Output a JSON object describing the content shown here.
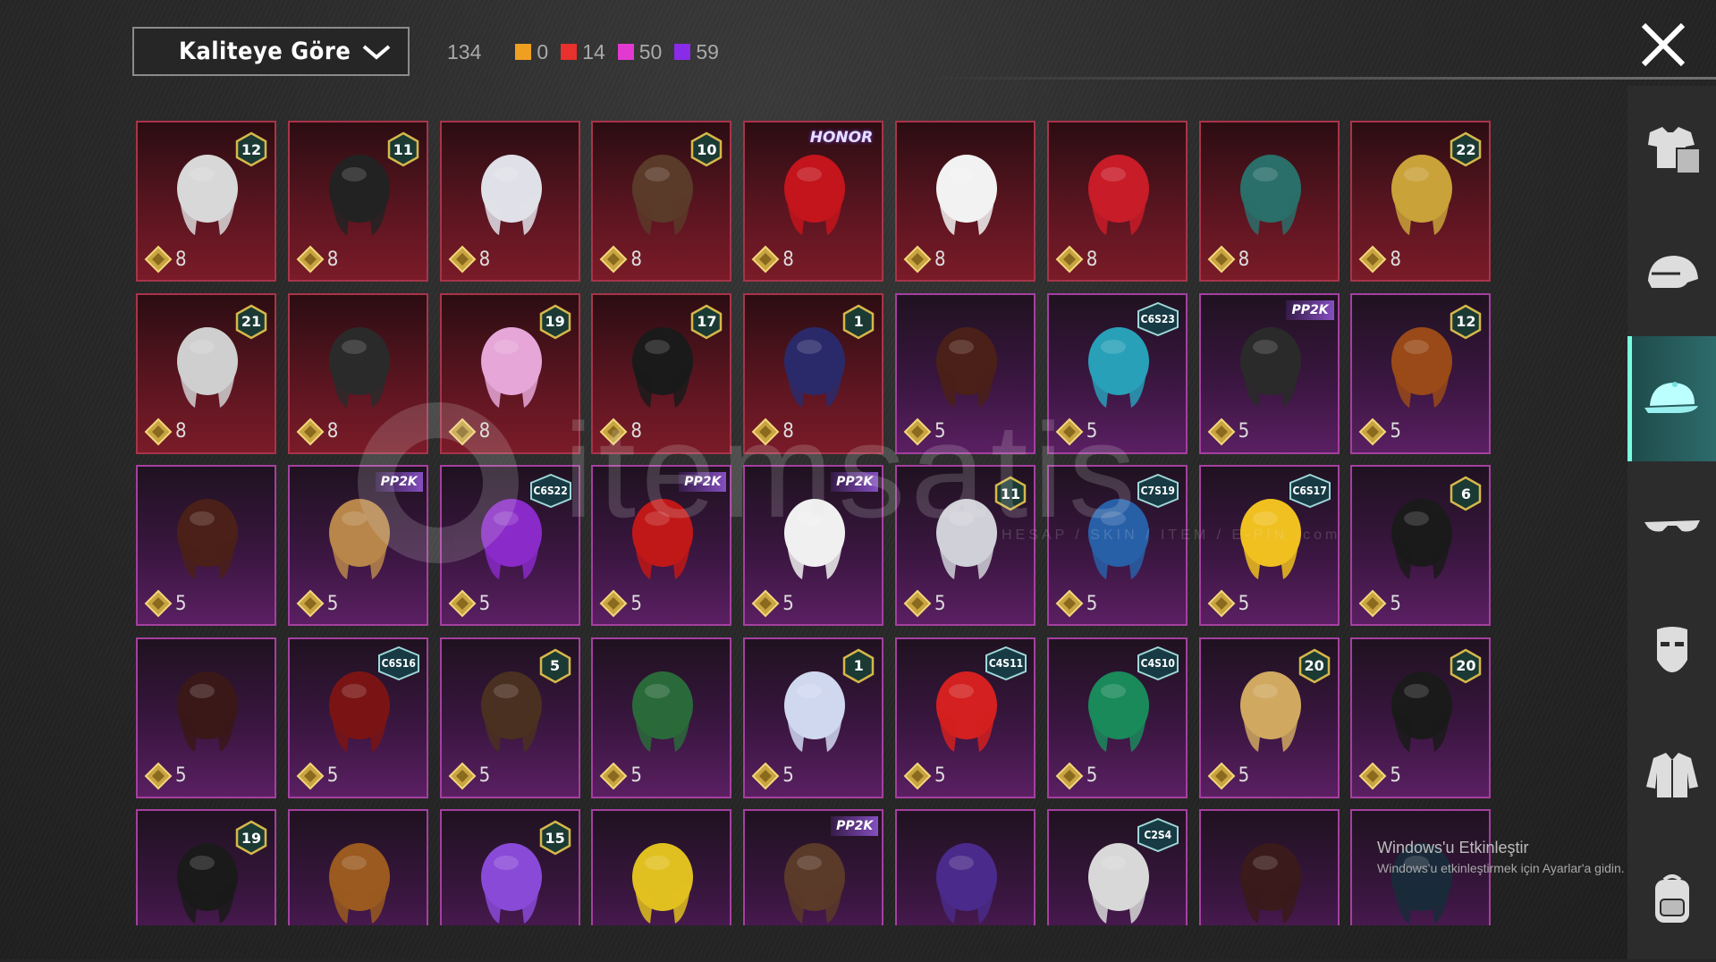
{
  "header": {
    "sort_dropdown": {
      "selected": "Kaliteye Göre"
    },
    "total_count": "134",
    "quality_counts": [
      {
        "color": "#f0a020",
        "count": "0"
      },
      {
        "color": "#e8302c",
        "count": "14"
      },
      {
        "color": "#e23ad0",
        "count": "50"
      },
      {
        "color": "#8a2be8",
        "count": "59"
      }
    ]
  },
  "sidebar": {
    "categories": [
      {
        "name": "outfit",
        "icon": "outfit-icon",
        "active": false
      },
      {
        "name": "helmet",
        "icon": "helmet-icon",
        "active": false
      },
      {
        "name": "hat",
        "icon": "cap-icon",
        "active": true
      },
      {
        "name": "glasses",
        "icon": "glasses-icon",
        "active": false
      },
      {
        "name": "mask",
        "icon": "mask-icon",
        "active": false
      },
      {
        "name": "jacket",
        "icon": "jacket-icon",
        "active": false
      },
      {
        "name": "backpack",
        "icon": "backpack-icon",
        "active": false
      }
    ]
  },
  "items": [
    {
      "rarity": "red",
      "cost": "8",
      "badge": "12",
      "icon": "white-hair-icon"
    },
    {
      "rarity": "red",
      "cost": "8",
      "badge": "11",
      "icon": "black-hair-icon"
    },
    {
      "rarity": "red",
      "cost": "8",
      "icon": "white-long-hair-icon"
    },
    {
      "rarity": "red",
      "cost": "8",
      "badge": "10",
      "icon": "brown-hair-icon"
    },
    {
      "rarity": "red",
      "cost": "8",
      "ribbon": "HONOR",
      "icon": "red-hair-icon"
    },
    {
      "rarity": "red",
      "cost": "8",
      "icon": "cowboy-hat-icon"
    },
    {
      "rarity": "red",
      "cost": "8",
      "icon": "red-helmet-icon"
    },
    {
      "rarity": "red",
      "cost": "8",
      "icon": "teal-helmet-icon"
    },
    {
      "rarity": "red",
      "cost": "8",
      "badge": "22",
      "icon": "gold-helmet-icon"
    },
    {
      "rarity": "red",
      "cost": "8",
      "badge": "21",
      "icon": "oni-mask-icon"
    },
    {
      "rarity": "red",
      "cost": "8",
      "icon": "fox-helmet-icon"
    },
    {
      "rarity": "red",
      "cost": "8",
      "badge": "19",
      "icon": "pink-helmet-icon"
    },
    {
      "rarity": "red",
      "cost": "8",
      "badge": "17",
      "icon": "gold-crown-icon"
    },
    {
      "rarity": "red",
      "cost": "8",
      "badge": "1",
      "icon": "dark-helmet-icon"
    },
    {
      "rarity": "purple",
      "cost": "5",
      "icon": "brown-hair-icon"
    },
    {
      "rarity": "purple",
      "cost": "5",
      "tag": "C6S23",
      "icon": "headphones-icon"
    },
    {
      "rarity": "purple",
      "cost": "5",
      "ribbon": "PP2K",
      "icon": "cap-icon"
    },
    {
      "rarity": "purple",
      "cost": "5",
      "badge": "12",
      "icon": "ponytail-icon"
    },
    {
      "rarity": "purple",
      "cost": "5",
      "icon": "horned-hair-icon"
    },
    {
      "rarity": "purple",
      "cost": "5",
      "ribbon": "PP2K",
      "icon": "alpaca-icon"
    },
    {
      "rarity": "purple",
      "cost": "5",
      "tag": "C6S22",
      "icon": "blue-hair-icon"
    },
    {
      "rarity": "purple",
      "cost": "5",
      "ribbon": "PP2K",
      "icon": "red-hair-icon"
    },
    {
      "rarity": "purple",
      "cost": "5",
      "ribbon": "PP2K",
      "icon": "panda-icon"
    },
    {
      "rarity": "purple",
      "cost": "5",
      "badge": "11",
      "icon": "flower-hair-icon"
    },
    {
      "rarity": "purple",
      "cost": "5",
      "tag": "C7S19",
      "icon": "dreadlocks-icon"
    },
    {
      "rarity": "purple",
      "cost": "5",
      "tag": "C6S17",
      "icon": "visor-icon"
    },
    {
      "rarity": "purple",
      "cost": "5",
      "badge": "6",
      "icon": "knight-helmet-icon"
    },
    {
      "rarity": "purple",
      "cost": "5",
      "icon": "bun-hair-icon"
    },
    {
      "rarity": "purple",
      "cost": "5",
      "tag": "C6S16",
      "icon": "bob-hair-icon"
    },
    {
      "rarity": "purple",
      "cost": "5",
      "badge": "5",
      "icon": "cat-ears-icon"
    },
    {
      "rarity": "purple",
      "cost": "5",
      "icon": "feather-headdress-icon"
    },
    {
      "rarity": "purple",
      "cost": "5",
      "badge": "1",
      "icon": "pigtails-icon"
    },
    {
      "rarity": "purple",
      "cost": "5",
      "tag": "C4S11",
      "icon": "red-cap-icon"
    },
    {
      "rarity": "purple",
      "cost": "5",
      "tag": "C4S10",
      "icon": "green-helmet-icon"
    },
    {
      "rarity": "purple",
      "cost": "5",
      "badge": "20",
      "icon": "blonde-hat-icon"
    },
    {
      "rarity": "purple",
      "cost": "5",
      "badge": "20",
      "icon": "black-gold-helmet-icon"
    },
    {
      "rarity": "purple",
      "badge": "19",
      "icon": "black-hair-bun-icon"
    },
    {
      "rarity": "purple",
      "icon": "dino-head-icon"
    },
    {
      "rarity": "purple",
      "badge": "15",
      "icon": "bird-helmet-icon"
    },
    {
      "rarity": "purple",
      "icon": "duck-hat-icon"
    },
    {
      "rarity": "purple",
      "ribbon": "PP2K",
      "icon": "gas-mask-icon"
    },
    {
      "rarity": "purple",
      "icon": "mecha-helmet-icon"
    },
    {
      "rarity": "purple",
      "tag": "C2S4",
      "icon": "white-hair-icon"
    },
    {
      "rarity": "purple",
      "icon": "top-hat-icon"
    },
    {
      "rarity": "purple",
      "icon": "dark-helmet-icon"
    }
  ],
  "watermark": {
    "brand": "itemsatis",
    "tagline": "HESAP / SKIN / ITEM / E-PIN .com"
  },
  "windows_activation": {
    "title": "Windows'u Etkinleştir",
    "subtitle": "Windows'u etkinleştirmek için Ayarlar'a gidin."
  }
}
